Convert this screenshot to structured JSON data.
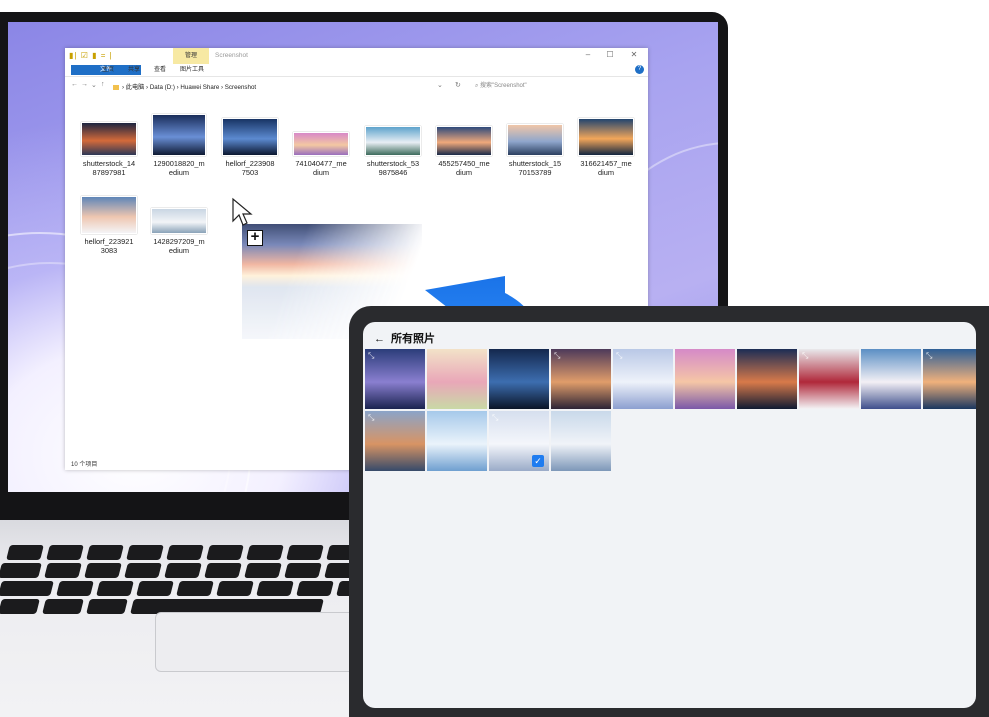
{
  "explorer": {
    "window_title": "Screenshot",
    "quick_access": "▮| ☑ ▮ = |",
    "manage_tab": "管理",
    "ribbon": {
      "file": "文件",
      "home": "主页",
      "share": "共享",
      "view": "查看",
      "picture_tools": "图片工具"
    },
    "window_controls": {
      "minimize": "–",
      "maximize": "☐",
      "close": "✕"
    },
    "help_glyph": "?",
    "nav": {
      "back": "←",
      "forward": "→",
      "dropdown": "⌄",
      "up": "↑"
    },
    "address_path": "› 此电脑 › Data (D:) › Huawei Share › Screenshot",
    "address_dropdown": "⌄",
    "refresh": "↻",
    "search_placeholder": "搜索\"Screenshot\"",
    "search_icon": "⌕",
    "files": [
      {
        "name": "shutterstock_14\n87897981",
        "colors": [
          "#1d2540",
          "#d46a3a",
          "#2c3756"
        ]
      },
      {
        "name": "1290018820_m\nedium",
        "colors": [
          "#1a2d5a",
          "#6a8fd6",
          "#0f1a33"
        ]
      },
      {
        "name": "hellorf_223908\n7503",
        "colors": [
          "#183464",
          "#5c8ad0",
          "#0c1730"
        ]
      },
      {
        "name": "741040477_me\ndium",
        "colors": [
          "#d889c8",
          "#f3c8a2",
          "#9a6fbd"
        ]
      },
      {
        "name": "shutterstock_53\n9875846",
        "colors": [
          "#5ea3cc",
          "#e8eef4",
          "#3d6b5c"
        ]
      },
      {
        "name": "455257450_me\ndium",
        "colors": [
          "#2f4a7b",
          "#f0a97b",
          "#1b2b4a"
        ]
      },
      {
        "name": "shutterstock_15\n70153789",
        "colors": [
          "#f0c6a8",
          "#8fa6cc",
          "#2b3f60"
        ]
      },
      {
        "name": "316621457_me\ndium",
        "colors": [
          "#23456f",
          "#f2a65a",
          "#132640"
        ]
      },
      {
        "name": "hellorf_223921\n3083",
        "colors": [
          "#5f86b8",
          "#eec6b0",
          "#f4f4f6"
        ]
      },
      {
        "name": "1428297209_m\nedium",
        "colors": [
          "#c9d6e3",
          "#f2f4f7",
          "#8aa2b8"
        ]
      }
    ],
    "status_text": "10 个项目"
  },
  "drag": {
    "plus": "+"
  },
  "tablet": {
    "back_glyph": "←",
    "title": "所有照片",
    "expand_glyph": "⤡",
    "check_glyph": "✓",
    "photos": [
      {
        "colors": [
          "#2b3d7a",
          "#8a7fd0",
          "#1a2350"
        ],
        "expand": true
      },
      {
        "colors": [
          "#f2e2c8",
          "#e9a7b8",
          "#c9d9a6"
        ],
        "expand": false
      },
      {
        "colors": [
          "#14284e",
          "#3d6eb0",
          "#0a1427"
        ],
        "expand": false
      },
      {
        "colors": [
          "#4d3a5a",
          "#e09d6a",
          "#2c2436"
        ],
        "expand": true
      },
      {
        "colors": [
          "#b9c8e6",
          "#eef2fa",
          "#8c9fd0"
        ],
        "expand": true
      },
      {
        "colors": [
          "#d58ac8",
          "#f5c6a6",
          "#7a58a8"
        ],
        "expand": false
      },
      {
        "colors": [
          "#1c2d55",
          "#d87a4a",
          "#0f1a33"
        ],
        "expand": false
      },
      {
        "colors": [
          "#e9e9ec",
          "#b0283a",
          "#f4f4f6"
        ],
        "expand": true
      },
      {
        "colors": [
          "#5b8fc4",
          "#f3f0f5",
          "#3f4f8c"
        ],
        "expand": false
      },
      {
        "colors": [
          "#2e5f96",
          "#f0b17c",
          "#1a3760"
        ],
        "expand": true
      },
      {
        "colors": [
          "#8ba4c8",
          "#d89464",
          "#364a6a"
        ],
        "expand": true
      },
      {
        "colors": [
          "#a6c9ea",
          "#eaf3fb",
          "#6f9fd0"
        ],
        "expand": false
      },
      {
        "colors": [
          "#d6dfee",
          "#f4f6fb",
          "#9aabc8"
        ],
        "expand": true,
        "checked": true
      },
      {
        "colors": [
          "#c9d9ea",
          "#f0f3f8",
          "#7d97b8"
        ],
        "expand": false
      }
    ]
  },
  "accent_color": "#1f7cf0"
}
